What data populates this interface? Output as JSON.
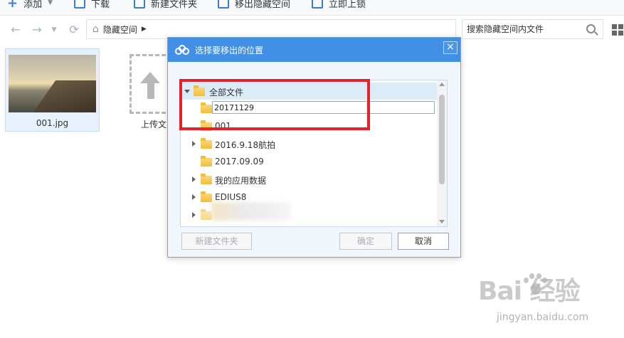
{
  "toolbar": {
    "add_label": "添加",
    "download_label": "下载",
    "new_folder_label": "新建文件夹",
    "move_out_label": "移出隐藏空间",
    "upload_now_label": "立即上锁"
  },
  "nav": {
    "path": "隐藏空间",
    "search_placeholder": "搜索隐藏空间内文件"
  },
  "files": [
    {
      "name": "001.jpg"
    }
  ],
  "upload_tile": {
    "label": "上传文"
  },
  "dialog": {
    "title": "选择要移出的位置",
    "rename_value": "20171129",
    "tree": [
      {
        "label": "全部文件",
        "expanded": true,
        "selected": true
      },
      {
        "label": "",
        "editing": true
      },
      {
        "label": "001"
      },
      {
        "label": "2016.9.18航拍",
        "expandable": true
      },
      {
        "label": "2017.09.09"
      },
      {
        "label": "我的应用数据",
        "expandable": true
      },
      {
        "label": "EDIUS8",
        "expandable": true
      }
    ],
    "buttons": {
      "new_folder": "新建文件夹",
      "confirm": "确定",
      "cancel": "取消"
    }
  },
  "colors": {
    "title_bar": "#4290e6",
    "highlight": "#e8202a",
    "selected_row": "#dcebf8"
  },
  "watermark": {
    "main": "Bai  经验",
    "sub": "jingyan.baidu.com"
  }
}
